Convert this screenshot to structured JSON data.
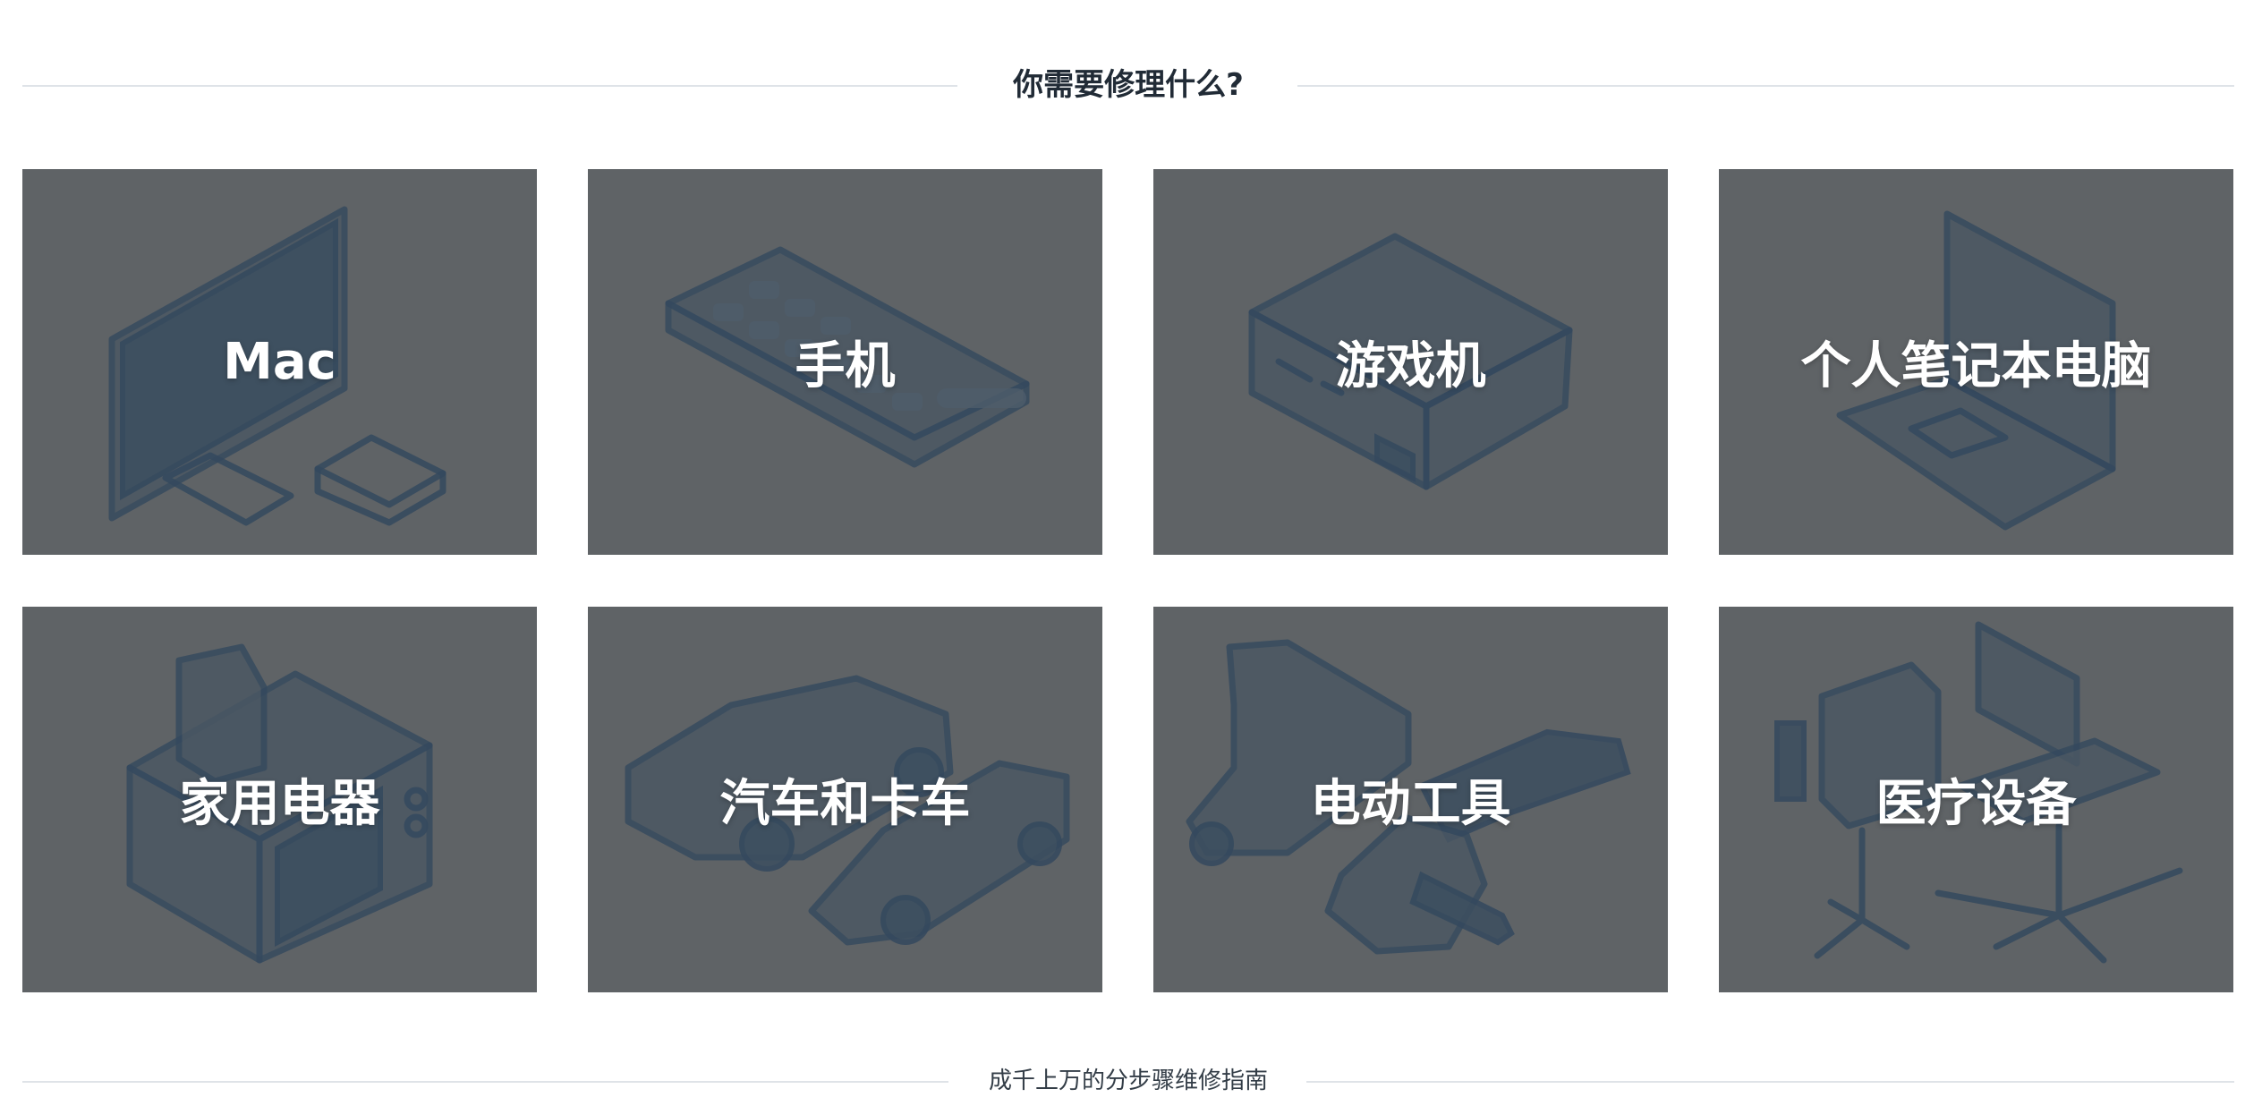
{
  "header": {
    "title": "你需要修理什么?"
  },
  "categories": [
    {
      "label": "Mac",
      "icon": "imac-icon"
    },
    {
      "label": "手机",
      "icon": "phone-icon"
    },
    {
      "label": "游戏机",
      "icon": "game-console-icon"
    },
    {
      "label": "个人笔记本电脑",
      "icon": "laptop-icon"
    },
    {
      "label": "家用电器",
      "icon": "appliance-icon"
    },
    {
      "label": "汽车和卡车",
      "icon": "car-truck-icon"
    },
    {
      "label": "电动工具",
      "icon": "power-tool-icon"
    },
    {
      "label": "医疗设备",
      "icon": "medical-device-icon"
    }
  ],
  "footer": {
    "tagline": "成千上万的分步骤维修指南"
  },
  "colors": {
    "card_bg": "#5f6366",
    "line_art": "#34495e",
    "title": "#212b36",
    "divider": "#dfe3e8"
  }
}
